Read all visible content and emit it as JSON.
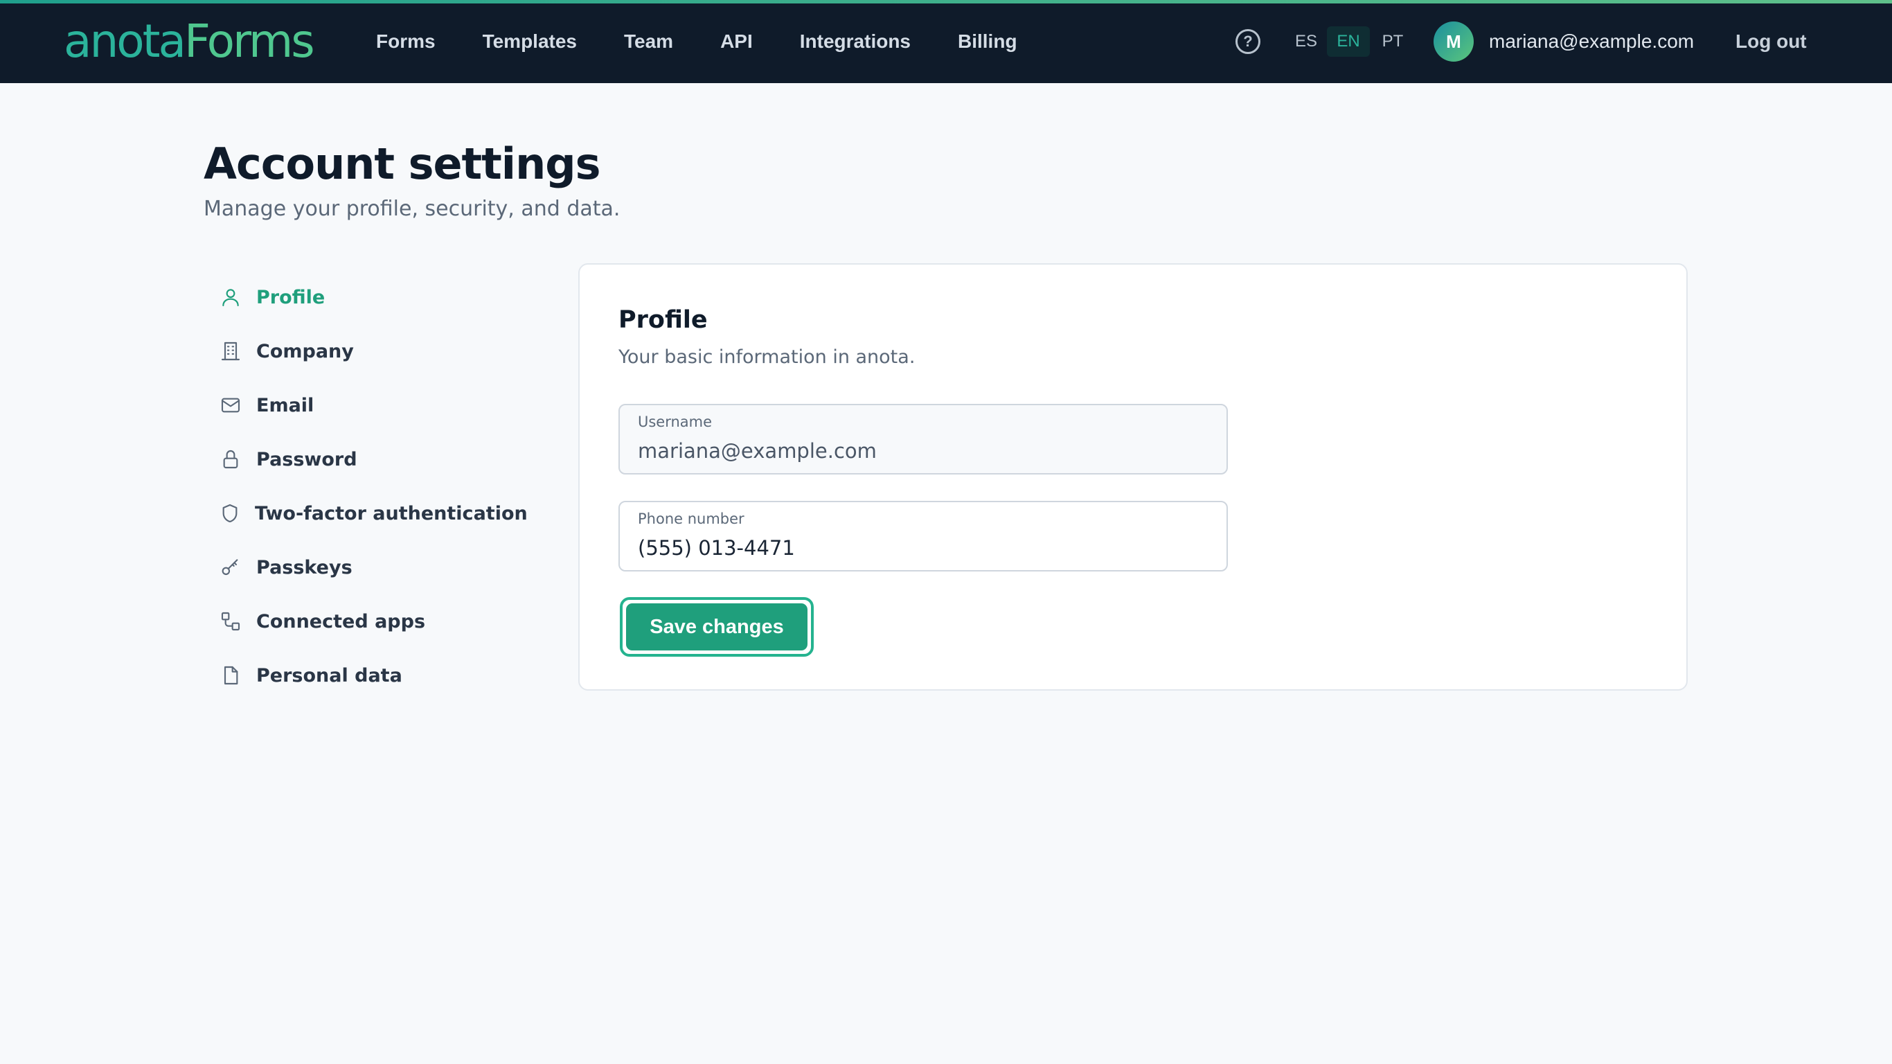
{
  "brand": {
    "name_part1": "anota",
    "name_part2": "Forms"
  },
  "nav": {
    "items": [
      {
        "label": "Forms"
      },
      {
        "label": "Templates"
      },
      {
        "label": "Team"
      },
      {
        "label": "API"
      },
      {
        "label": "Integrations"
      },
      {
        "label": "Billing"
      }
    ]
  },
  "header": {
    "help_glyph": "?",
    "languages": [
      {
        "code": "ES",
        "active": false
      },
      {
        "code": "EN",
        "active": true
      },
      {
        "code": "PT",
        "active": false
      }
    ],
    "avatar_initial": "M",
    "user_email": "mariana@example.com",
    "logout_label": "Log out"
  },
  "page": {
    "title": "Account settings",
    "subtitle": "Manage your profile, security, and data."
  },
  "sidebar": {
    "items": [
      {
        "label": "Profile",
        "icon": "user-icon",
        "active": true
      },
      {
        "label": "Company",
        "icon": "building-icon",
        "active": false
      },
      {
        "label": "Email",
        "icon": "envelope-icon",
        "active": false
      },
      {
        "label": "Password",
        "icon": "lock-icon",
        "active": false
      },
      {
        "label": "Two-factor authentication",
        "icon": "shield-icon",
        "active": false
      },
      {
        "label": "Passkeys",
        "icon": "key-icon",
        "active": false
      },
      {
        "label": "Connected apps",
        "icon": "connected-apps-icon",
        "active": false
      },
      {
        "label": "Personal data",
        "icon": "document-icon",
        "active": false
      }
    ]
  },
  "profile": {
    "title": "Profile",
    "subtitle": "Your basic information in anota.",
    "username_label": "Username",
    "username_value": "mariana@example.com",
    "phone_label": "Phone number",
    "phone_value": "(555) 013-4471",
    "save_label": "Save changes"
  },
  "colors": {
    "topbar_bg": "#0f1b2a",
    "accent": "#1f9f7c",
    "page_bg": "#f7f9fb"
  }
}
